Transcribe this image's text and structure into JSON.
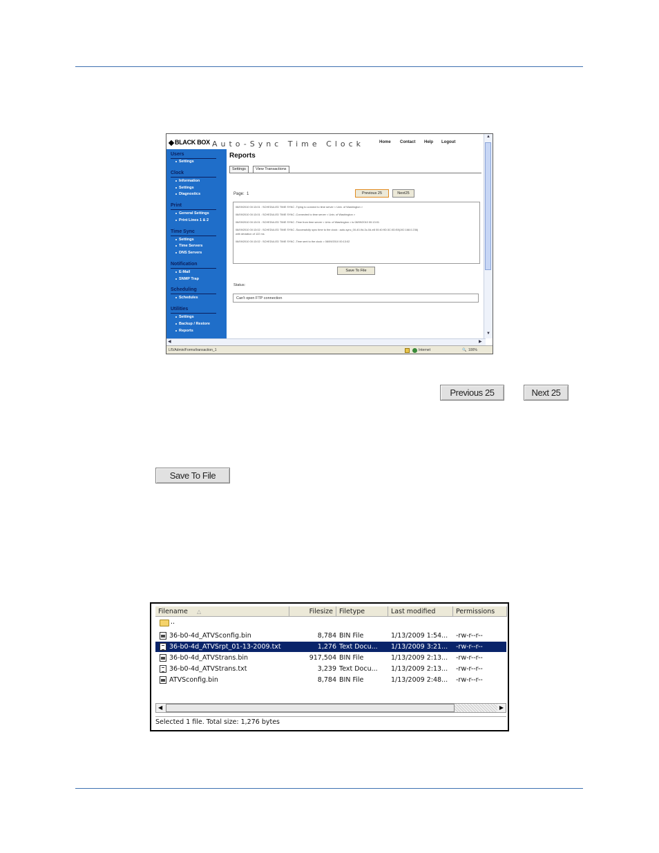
{
  "shot1": {
    "brand": "BLACK BOX",
    "app_title": "Auto-Sync Time Clock",
    "top_nav": [
      "Home",
      "Contact",
      "Help",
      "Logout"
    ],
    "sidebar": [
      {
        "section": "Users",
        "items": [
          "Settings"
        ]
      },
      {
        "section": "Clock",
        "items": [
          "Information",
          "Settings",
          "Diagnostics"
        ]
      },
      {
        "section": "Print",
        "items": [
          "General Settings",
          "Print Lines 1 & 2"
        ]
      },
      {
        "section": "Time Sync",
        "items": [
          "Settings",
          "Time Servers",
          "DNS Servers"
        ]
      },
      {
        "section": "Notification",
        "items": [
          "E-Mail",
          "SNMP Trap"
        ]
      },
      {
        "section": "Scheduling",
        "items": [
          "Schedules"
        ]
      },
      {
        "section": "Utilities",
        "items": [
          "Settings",
          "Backup / Restore",
          "Reports"
        ]
      }
    ],
    "page_title": "Reports",
    "tabs": [
      "Settings",
      "View Transactions"
    ],
    "page_label": "Page:",
    "page_number": "1",
    "prev_button": "Previous 25",
    "next_button": "Next25",
    "log_lines": [
      "08/09/2010 00:13:01 : SCHEDULED TIME SYNC -Trying to connect to time server < Univ. of Washington >",
      "08/09/2010 00:13:01 : SCHEDULED TIME SYNC -Connected to time server < Univ. of Washington >",
      "08/09/2010 00:13:01 : SCHEDULED TIME SYNC -Time from time server < Univ. of Washington > is 08/09/2010 00:13:01",
      "08/09/2010 00:13:02 : SCHEDULED TIME SYNC -Successfully sync time to the clock : auto-sync_00-40-9d-3c-0d-e8 00:40:9D:3C:0D:E8(192.168.0.236)",
      "with deviation of 122 ms",
      "08/09/2010 00:13:02 : SCHEDULED TIME SYNC -Time sent to the clock = 08/09/2010 00:13:02"
    ],
    "save_button": "Save To File",
    "status_label": "Status:",
    "status_value": "Can't open FTP connection",
    "url": "L/5/Admin/Forms/transaction_1",
    "zone": "Internet",
    "zoom": "100%"
  },
  "buttons": {
    "previous": "Previous 25",
    "next": "Next 25",
    "save": "Save To File"
  },
  "shot2": {
    "columns": [
      "Filename",
      "Filesize",
      "Filetype",
      "Last modified",
      "Permissions"
    ],
    "parent_dir": "..",
    "rows": [
      {
        "name": "36-b0-4d_ATVSconfig.bin",
        "size": "8,784",
        "type": "BIN File",
        "modified": "1/13/2009 1:54...",
        "perm": "-rw-r--r--",
        "icon": "bin",
        "selected": false
      },
      {
        "name": "36-b0-4d_ATVSrpt_01-13-2009.txt",
        "size": "1,276",
        "type": "Text Docu...",
        "modified": "1/13/2009 3:21...",
        "perm": "-rw-r--r--",
        "icon": "txt",
        "selected": true
      },
      {
        "name": "36-b0-4d_ATVStrans.bin",
        "size": "917,504",
        "type": "BIN File",
        "modified": "1/13/2009 2:13...",
        "perm": "-rw-r--r--",
        "icon": "bin",
        "selected": false
      },
      {
        "name": "36-b0-4d_ATVStrans.txt",
        "size": "3,239",
        "type": "Text Docu...",
        "modified": "1/13/2009 2:13...",
        "perm": "-rw-r--r--",
        "icon": "txt",
        "selected": false
      },
      {
        "name": "ATVSconfig.bin",
        "size": "8,784",
        "type": "BIN File",
        "modified": "1/13/2009 2:48...",
        "perm": "-rw-r--r--",
        "icon": "bin",
        "selected": false
      }
    ],
    "status": "Selected 1 file. Total size: 1,276 bytes"
  }
}
